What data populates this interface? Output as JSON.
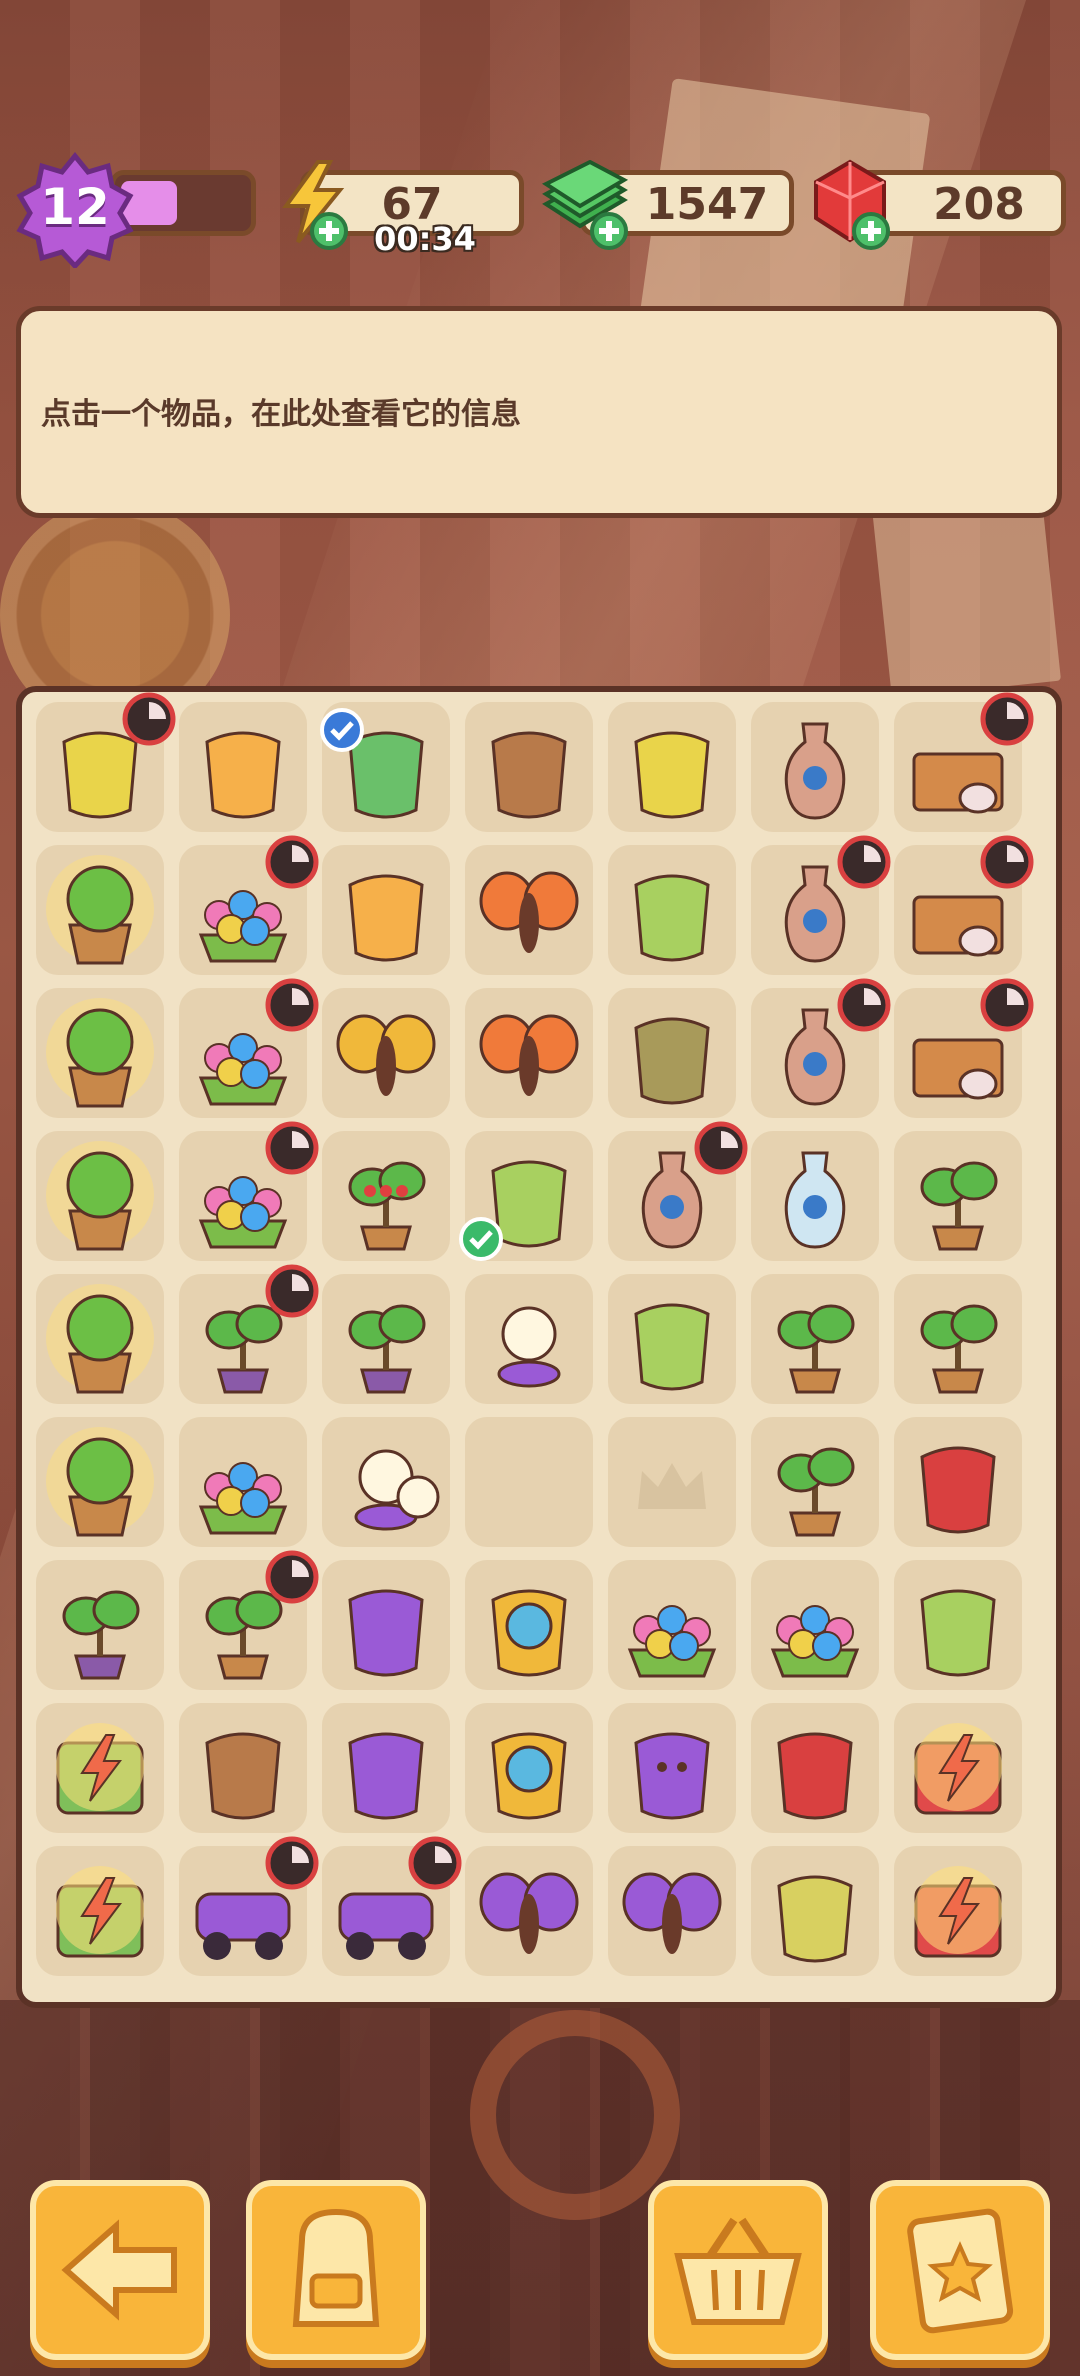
{
  "hud": {
    "level": "12",
    "level_progress": 0.42,
    "energy": "67",
    "energy_timer": "00:34",
    "cash": "1547",
    "gems": "208"
  },
  "info_panel": {
    "text": "点击一个物品，在此处查看它的信息"
  },
  "colors": {
    "accent": "#f9b53a",
    "panel": "#f5e3c2",
    "board": "#f1e2c5",
    "level": "#b65ad6",
    "plus": "#4ec06a"
  },
  "board": {
    "rows": [
      [
        "yellow-bucket-item",
        "fruit-smoothie-cup-item",
        "broom-item",
        "clay-pot-item",
        "yellow-pail-item",
        "crystal-vase-item",
        "pottery-crate-item"
      ],
      [
        "glowing-tree-pot-item",
        "flower-bee-bed-item",
        "juice-jar-item",
        "butterfly-item",
        "green-bowl-item",
        "painted-vase-item",
        "pottery-crate-item"
      ],
      [
        "glowing-tree-pot-item",
        "flower-bee-bed-item",
        "bee-item",
        "butterfly-item",
        "sandbag-item",
        "striped-vase-item",
        "pottery-crate-item"
      ],
      [
        "glowing-tree-pot-item",
        "flower-bee-bed-item",
        "berry-bush-item",
        "mossy-stone-item",
        "small-vase-item",
        "glass-vase-item",
        "leaf-sprout-item"
      ],
      [
        "glowing-tree-pot-item",
        "bonsai-tree-item",
        "bonsai-tree-item",
        "orb-lamp-item",
        "melon-item",
        "leaf-pair-item",
        "leafy-plant-item"
      ],
      [
        "glowing-tree-pot-item",
        "flower-basket-item",
        "double-orb-lamp-item",
        "empty-cell",
        "locked-cell",
        "seedling-item",
        "gloves-item"
      ],
      [
        "small-bonsai-item",
        "potted-plant-item",
        "knitting-item",
        "magnifier-item",
        "yellow-flower-pot-item",
        "flower-planter-item",
        "hat-item"
      ],
      [
        "energy-chest-item",
        "trench-coat-item",
        "purple-sweater-item",
        "glasses-item",
        "purple-blob-item",
        "pruning-shears-item",
        "energy-box-item"
      ],
      [
        "energy-chest-item",
        "purple-car-item",
        "purple-motorbike-item",
        "purple-moth-item",
        "purple-moth-item",
        "seed-sack-item",
        "energy-box-item"
      ]
    ]
  },
  "buttons": {
    "back": "back-arrow-icon",
    "bag": "backpack-icon",
    "shop": "basket-icon",
    "quests": "clipboard-star-icon"
  }
}
